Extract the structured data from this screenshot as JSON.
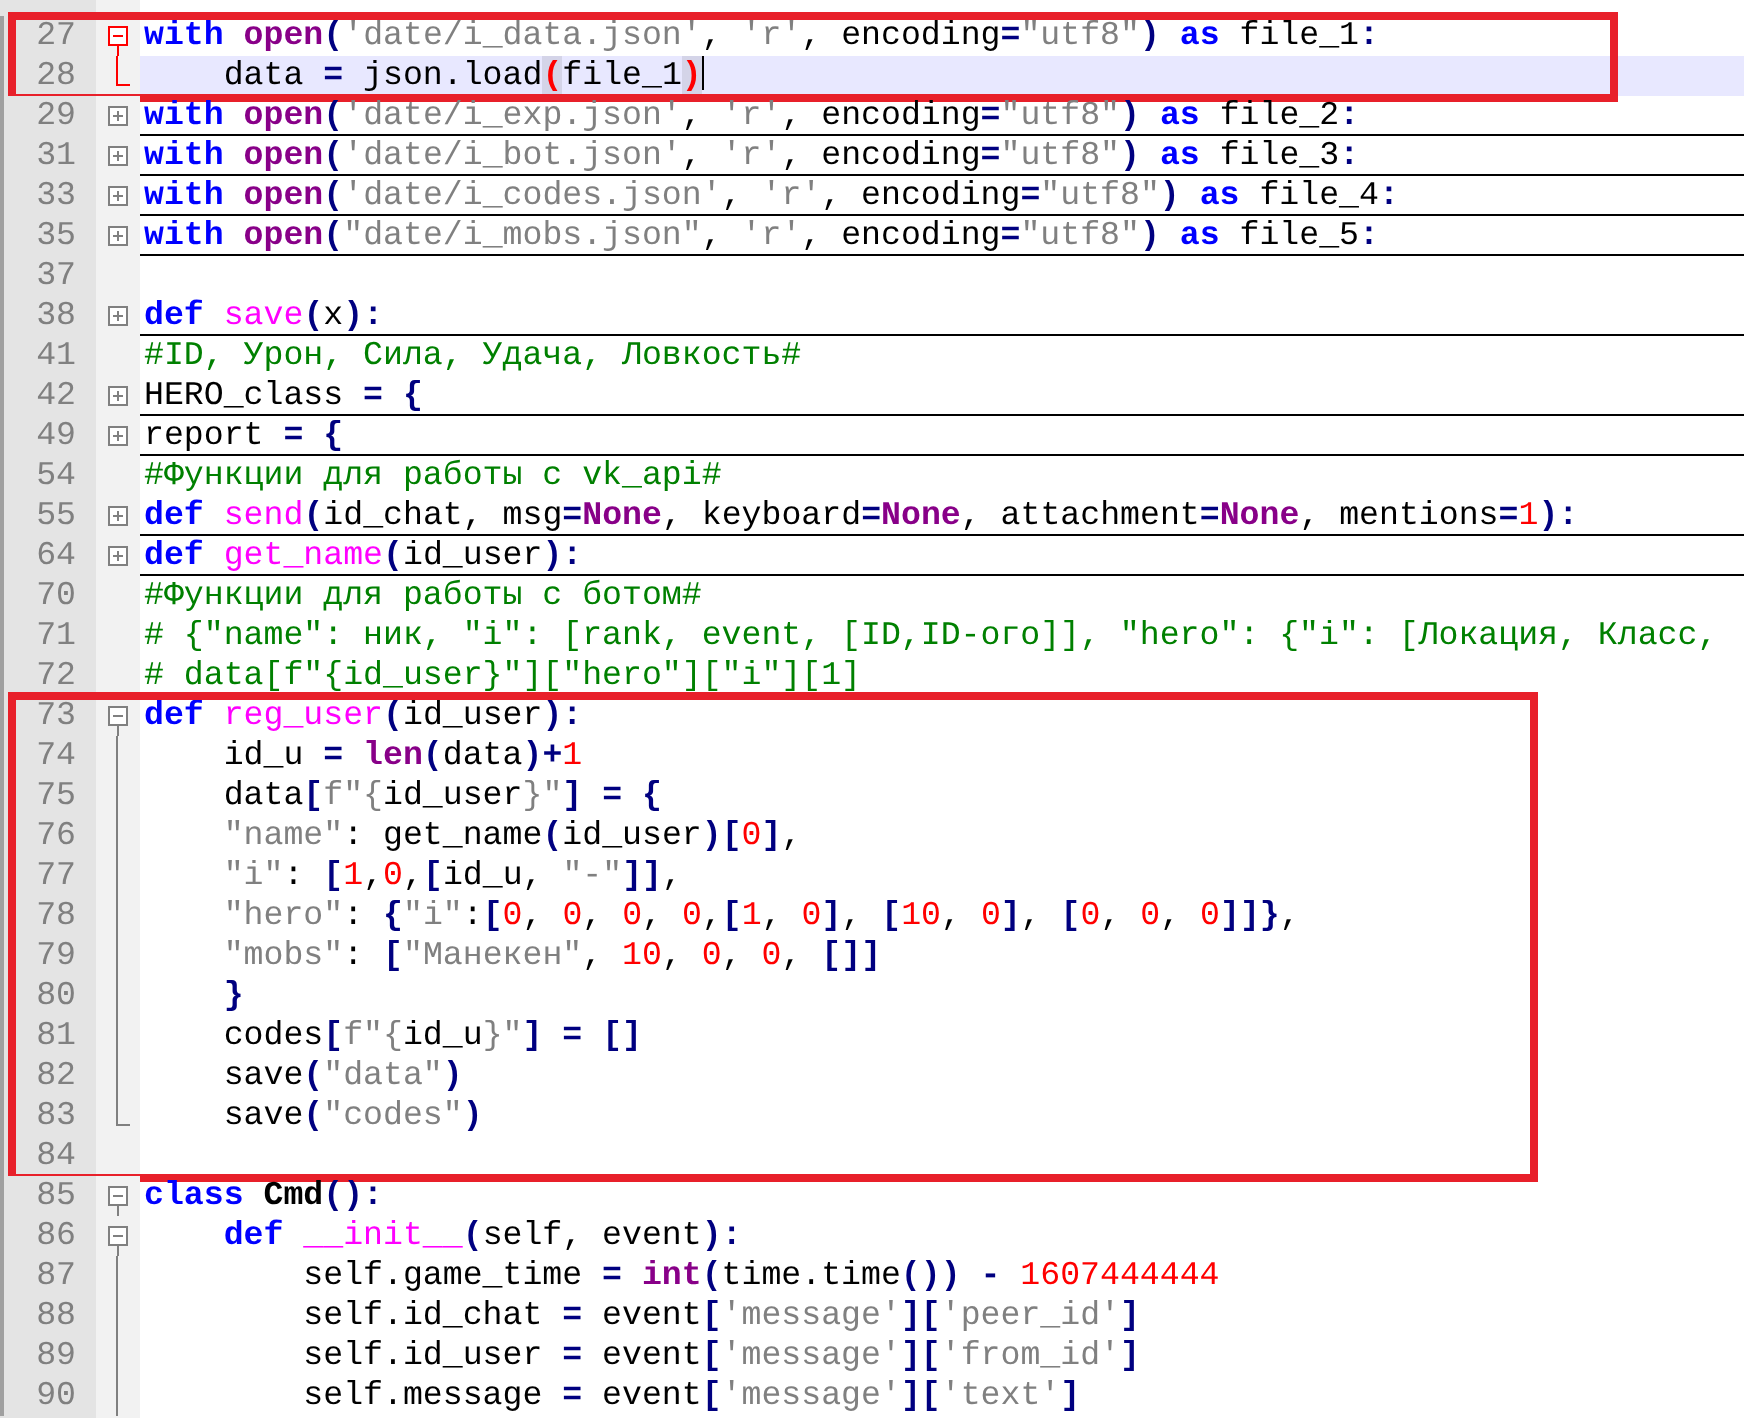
{
  "editor": {
    "blocks": [
      {
        "annotated": true,
        "fold_highlighted": true,
        "lines": [
          {
            "number": "27",
            "kind": "fold_open",
            "current": false,
            "tokens": [
              {
                "kind": "keyword",
                "text": "with "
              },
              {
                "kind": "builtin",
                "text": "open"
              },
              {
                "kind": "operator",
                "text": "("
              },
              {
                "kind": "string",
                "text": "'date/i_data.json'"
              },
              {
                "kind": "text",
                "text": ", "
              },
              {
                "kind": "string",
                "text": "'r'"
              },
              {
                "kind": "text",
                "text": ", encoding"
              },
              {
                "kind": "operator",
                "text": "="
              },
              {
                "kind": "string",
                "text": "\"utf8\""
              },
              {
                "kind": "operator",
                "text": ") "
              },
              {
                "kind": "keyword",
                "text": "as"
              },
              {
                "kind": "text",
                "text": " file_1"
              },
              {
                "kind": "operator",
                "text": ":"
              }
            ]
          },
          {
            "number": "28",
            "kind": "fold_end",
            "current": true,
            "tokens": [
              {
                "kind": "text",
                "text": "    data "
              },
              {
                "kind": "operator",
                "text": "="
              },
              {
                "kind": "text",
                "text": " json.load"
              },
              {
                "kind": "brace_match",
                "text": "("
              },
              {
                "kind": "text",
                "text": "file_1"
              },
              {
                "kind": "brace_match",
                "text": ")"
              }
            ]
          }
        ]
      },
      {
        "annotated": false,
        "fold_highlighted": false,
        "lines": [
          {
            "number": "29",
            "kind": "fold_closed",
            "current": false,
            "tokens": [
              {
                "kind": "keyword",
                "text": "with "
              },
              {
                "kind": "builtin",
                "text": "open"
              },
              {
                "kind": "operator",
                "text": "("
              },
              {
                "kind": "string",
                "text": "'date/i_exp.json'"
              },
              {
                "kind": "text",
                "text": ", "
              },
              {
                "kind": "string",
                "text": "'r'"
              },
              {
                "kind": "text",
                "text": ", encoding"
              },
              {
                "kind": "operator",
                "text": "="
              },
              {
                "kind": "string",
                "text": "\"utf8\""
              },
              {
                "kind": "operator",
                "text": ") "
              },
              {
                "kind": "keyword",
                "text": "as"
              },
              {
                "kind": "text",
                "text": " file_2"
              },
              {
                "kind": "operator",
                "text": ":"
              }
            ]
          },
          {
            "number": "31",
            "kind": "fold_closed",
            "current": false,
            "tokens": [
              {
                "kind": "keyword",
                "text": "with "
              },
              {
                "kind": "builtin",
                "text": "open"
              },
              {
                "kind": "operator",
                "text": "("
              },
              {
                "kind": "string",
                "text": "'date/i_bot.json'"
              },
              {
                "kind": "text",
                "text": ", "
              },
              {
                "kind": "string",
                "text": "'r'"
              },
              {
                "kind": "text",
                "text": ", encoding"
              },
              {
                "kind": "operator",
                "text": "="
              },
              {
                "kind": "string",
                "text": "\"utf8\""
              },
              {
                "kind": "operator",
                "text": ") "
              },
              {
                "kind": "keyword",
                "text": "as"
              },
              {
                "kind": "text",
                "text": " file_3"
              },
              {
                "kind": "operator",
                "text": ":"
              }
            ]
          },
          {
            "number": "33",
            "kind": "fold_closed",
            "current": false,
            "tokens": [
              {
                "kind": "keyword",
                "text": "with "
              },
              {
                "kind": "builtin",
                "text": "open"
              },
              {
                "kind": "operator",
                "text": "("
              },
              {
                "kind": "string",
                "text": "'date/i_codes.json'"
              },
              {
                "kind": "text",
                "text": ", "
              },
              {
                "kind": "string",
                "text": "'r'"
              },
              {
                "kind": "text",
                "text": ", encoding"
              },
              {
                "kind": "operator",
                "text": "="
              },
              {
                "kind": "string",
                "text": "\"utf8\""
              },
              {
                "kind": "operator",
                "text": ") "
              },
              {
                "kind": "keyword",
                "text": "as"
              },
              {
                "kind": "text",
                "text": " file_4"
              },
              {
                "kind": "operator",
                "text": ":"
              }
            ]
          },
          {
            "number": "35",
            "kind": "fold_closed",
            "current": false,
            "tokens": [
              {
                "kind": "keyword",
                "text": "with "
              },
              {
                "kind": "builtin",
                "text": "open"
              },
              {
                "kind": "operator",
                "text": "("
              },
              {
                "kind": "string",
                "text": "\"date/i_mobs.json\""
              },
              {
                "kind": "text",
                "text": ", "
              },
              {
                "kind": "string",
                "text": "'r'"
              },
              {
                "kind": "text",
                "text": ", encoding"
              },
              {
                "kind": "operator",
                "text": "="
              },
              {
                "kind": "string",
                "text": "\"utf8\""
              },
              {
                "kind": "operator",
                "text": ") "
              },
              {
                "kind": "keyword",
                "text": "as"
              },
              {
                "kind": "text",
                "text": " file_5"
              },
              {
                "kind": "operator",
                "text": ":"
              }
            ]
          },
          {
            "number": "37",
            "kind": "plain",
            "current": false
          },
          {
            "number": "38",
            "kind": "fold_closed",
            "current": false,
            "tokens": [
              {
                "kind": "keyword",
                "text": "def "
              },
              {
                "kind": "function",
                "text": "save"
              },
              {
                "kind": "operator",
                "text": "("
              },
              {
                "kind": "text",
                "text": "x"
              },
              {
                "kind": "operator",
                "text": "):"
              }
            ]
          },
          {
            "number": "41",
            "kind": "plain",
            "current": false,
            "tokens": [
              {
                "kind": "comment",
                "text": "#ID, Урон, Сила, Удача, Ловкость#"
              }
            ]
          },
          {
            "number": "42",
            "kind": "fold_closed",
            "current": false,
            "tokens": [
              {
                "kind": "text",
                "text": "HERO_class "
              },
              {
                "kind": "operator",
                "text": "= {"
              }
            ]
          },
          {
            "number": "49",
            "kind": "fold_closed",
            "current": false,
            "tokens": [
              {
                "kind": "text",
                "text": "report "
              },
              {
                "kind": "operator",
                "text": "= {"
              }
            ]
          },
          {
            "number": "54",
            "kind": "plain",
            "current": false,
            "tokens": [
              {
                "kind": "comment",
                "text": "#Функции для работы с vk_api#"
              }
            ]
          },
          {
            "number": "55",
            "kind": "fold_closed",
            "current": false,
            "tokens": [
              {
                "kind": "keyword",
                "text": "def "
              },
              {
                "kind": "function",
                "text": "send"
              },
              {
                "kind": "operator",
                "text": "("
              },
              {
                "kind": "text",
                "text": "id_chat, msg"
              },
              {
                "kind": "operator",
                "text": "="
              },
              {
                "kind": "builtin",
                "text": "None"
              },
              {
                "kind": "text",
                "text": ", keyboard"
              },
              {
                "kind": "operator",
                "text": "="
              },
              {
                "kind": "builtin",
                "text": "None"
              },
              {
                "kind": "text",
                "text": ", attachment"
              },
              {
                "kind": "operator",
                "text": "="
              },
              {
                "kind": "builtin",
                "text": "None"
              },
              {
                "kind": "text",
                "text": ", mentions"
              },
              {
                "kind": "operator",
                "text": "="
              },
              {
                "kind": "number",
                "text": "1"
              },
              {
                "kind": "operator",
                "text": "):"
              }
            ]
          },
          {
            "number": "64",
            "kind": "fold_closed",
            "current": false,
            "tokens": [
              {
                "kind": "keyword",
                "text": "def "
              },
              {
                "kind": "function",
                "text": "get_name"
              },
              {
                "kind": "operator",
                "text": "("
              },
              {
                "kind": "text",
                "text": "id_user"
              },
              {
                "kind": "operator",
                "text": "):"
              }
            ]
          },
          {
            "number": "70",
            "kind": "plain",
            "current": false,
            "tokens": [
              {
                "kind": "comment",
                "text": "#Функции для работы с ботом#"
              }
            ]
          },
          {
            "number": "71",
            "kind": "plain",
            "current": false,
            "tokens": [
              {
                "kind": "comment",
                "text": "# {\"name\": ник, \"i\": [rank, event, [ID,ID-ого]], \"hero\": {\"i\": [Локация, Класс,"
              }
            ]
          },
          {
            "number": "72",
            "kind": "plain",
            "current": false,
            "tokens": [
              {
                "kind": "comment",
                "text": "# data[f\"{id_user}\"][\"hero\"][\"i\"][1]"
              }
            ]
          }
        ]
      },
      {
        "annotated": true,
        "fold_highlighted": false,
        "lines": [
          {
            "number": "73",
            "kind": "fold_open",
            "current": false,
            "tokens": [
              {
                "kind": "keyword",
                "text": "def "
              },
              {
                "kind": "function",
                "text": "reg_user"
              },
              {
                "kind": "operator",
                "text": "("
              },
              {
                "kind": "text",
                "text": "id_user"
              },
              {
                "kind": "operator",
                "text": "):"
              }
            ]
          },
          {
            "number": "74",
            "kind": "fold_body",
            "current": false,
            "tokens": [
              {
                "kind": "text",
                "text": "    id_u "
              },
              {
                "kind": "operator",
                "text": "= "
              },
              {
                "kind": "builtin",
                "text": "len"
              },
              {
                "kind": "operator",
                "text": "("
              },
              {
                "kind": "text",
                "text": "data"
              },
              {
                "kind": "operator",
                "text": ")+"
              },
              {
                "kind": "number",
                "text": "1"
              }
            ]
          },
          {
            "number": "75",
            "kind": "fold_body",
            "current": false,
            "tokens": [
              {
                "kind": "text",
                "text": "    data"
              },
              {
                "kind": "operator",
                "text": "["
              },
              {
                "kind": "string",
                "text": "f\"{"
              },
              {
                "kind": "text",
                "text": "id_user"
              },
              {
                "kind": "string",
                "text": "}\""
              },
              {
                "kind": "operator",
                "text": "] = {"
              }
            ]
          },
          {
            "number": "76",
            "kind": "fold_body",
            "current": false,
            "tokens": [
              {
                "kind": "string",
                "text": "    \"name\""
              },
              {
                "kind": "text",
                "text": ": get_name"
              },
              {
                "kind": "operator",
                "text": "("
              },
              {
                "kind": "text",
                "text": "id_user"
              },
              {
                "kind": "operator",
                "text": ")["
              },
              {
                "kind": "number",
                "text": "0"
              },
              {
                "kind": "operator",
                "text": "]"
              },
              {
                "kind": "text",
                "text": ","
              }
            ]
          },
          {
            "number": "77",
            "kind": "fold_body",
            "current": false,
            "tokens": [
              {
                "kind": "string",
                "text": "    \"i\""
              },
              {
                "kind": "text",
                "text": ": "
              },
              {
                "kind": "operator",
                "text": "["
              },
              {
                "kind": "number",
                "text": "1"
              },
              {
                "kind": "text",
                "text": ","
              },
              {
                "kind": "number",
                "text": "0"
              },
              {
                "kind": "text",
                "text": ","
              },
              {
                "kind": "operator",
                "text": "["
              },
              {
                "kind": "text",
                "text": "id_u, "
              },
              {
                "kind": "string",
                "text": "\"-\""
              },
              {
                "kind": "operator",
                "text": "]]"
              },
              {
                "kind": "text",
                "text": ","
              }
            ]
          },
          {
            "number": "78",
            "kind": "fold_body",
            "current": false,
            "tokens": [
              {
                "kind": "string",
                "text": "    \"hero\""
              },
              {
                "kind": "text",
                "text": ": "
              },
              {
                "kind": "operator",
                "text": "{"
              },
              {
                "kind": "string",
                "text": "\"i\""
              },
              {
                "kind": "text",
                "text": ":"
              },
              {
                "kind": "operator",
                "text": "["
              },
              {
                "kind": "number",
                "text": "0"
              },
              {
                "kind": "text",
                "text": ", "
              },
              {
                "kind": "number",
                "text": "0"
              },
              {
                "kind": "text",
                "text": ", "
              },
              {
                "kind": "number",
                "text": "0"
              },
              {
                "kind": "text",
                "text": ", "
              },
              {
                "kind": "number",
                "text": "0"
              },
              {
                "kind": "text",
                "text": ","
              },
              {
                "kind": "operator",
                "text": "["
              },
              {
                "kind": "number",
                "text": "1"
              },
              {
                "kind": "text",
                "text": ", "
              },
              {
                "kind": "number",
                "text": "0"
              },
              {
                "kind": "operator",
                "text": "]"
              },
              {
                "kind": "text",
                "text": ", "
              },
              {
                "kind": "operator",
                "text": "["
              },
              {
                "kind": "number",
                "text": "10"
              },
              {
                "kind": "text",
                "text": ", "
              },
              {
                "kind": "number",
                "text": "0"
              },
              {
                "kind": "operator",
                "text": "]"
              },
              {
                "kind": "text",
                "text": ", "
              },
              {
                "kind": "operator",
                "text": "["
              },
              {
                "kind": "number",
                "text": "0"
              },
              {
                "kind": "text",
                "text": ", "
              },
              {
                "kind": "number",
                "text": "0"
              },
              {
                "kind": "text",
                "text": ", "
              },
              {
                "kind": "number",
                "text": "0"
              },
              {
                "kind": "operator",
                "text": "]]}"
              },
              {
                "kind": "text",
                "text": ","
              }
            ]
          },
          {
            "number": "79",
            "kind": "fold_body",
            "current": false,
            "tokens": [
              {
                "kind": "string",
                "text": "    \"mobs\""
              },
              {
                "kind": "text",
                "text": ": "
              },
              {
                "kind": "operator",
                "text": "["
              },
              {
                "kind": "string",
                "text": "\"Манекен\""
              },
              {
                "kind": "text",
                "text": ", "
              },
              {
                "kind": "number",
                "text": "10"
              },
              {
                "kind": "text",
                "text": ", "
              },
              {
                "kind": "number",
                "text": "0"
              },
              {
                "kind": "text",
                "text": ", "
              },
              {
                "kind": "number",
                "text": "0"
              },
              {
                "kind": "text",
                "text": ", "
              },
              {
                "kind": "operator",
                "text": "[]]"
              }
            ]
          },
          {
            "number": "80",
            "kind": "fold_body",
            "current": false,
            "tokens": [
              {
                "kind": "operator",
                "text": "    }"
              }
            ]
          },
          {
            "number": "81",
            "kind": "fold_body",
            "current": false,
            "tokens": [
              {
                "kind": "text",
                "text": "    codes"
              },
              {
                "kind": "operator",
                "text": "["
              },
              {
                "kind": "string",
                "text": "f\"{"
              },
              {
                "kind": "text",
                "text": "id_u"
              },
              {
                "kind": "string",
                "text": "}\""
              },
              {
                "kind": "operator",
                "text": "] = []"
              }
            ]
          },
          {
            "number": "82",
            "kind": "fold_body",
            "current": false,
            "tokens": [
              {
                "kind": "text",
                "text": "    save"
              },
              {
                "kind": "operator",
                "text": "("
              },
              {
                "kind": "string",
                "text": "\"data\""
              },
              {
                "kind": "operator",
                "text": ")"
              }
            ]
          },
          {
            "number": "83",
            "kind": "fold_end",
            "current": false,
            "tokens": [
              {
                "kind": "text",
                "text": "    save"
              },
              {
                "kind": "operator",
                "text": "("
              },
              {
                "kind": "string",
                "text": "\"codes\""
              },
              {
                "kind": "operator",
                "text": ")"
              }
            ]
          },
          {
            "number": "84",
            "kind": "plain",
            "current": false
          }
        ]
      },
      {
        "annotated": false,
        "fold_highlighted": false,
        "lines": [
          {
            "number": "85",
            "kind": "fold_open",
            "current": false,
            "tokens": [
              {
                "kind": "keyword",
                "text": "class "
              },
              {
                "kind": "class_name",
                "text": "Cmd"
              },
              {
                "kind": "operator",
                "text": "():"
              }
            ]
          },
          {
            "number": "86",
            "kind": "fold_open",
            "current": false,
            "tokens": [
              {
                "kind": "keyword",
                "text": "    def "
              },
              {
                "kind": "function",
                "text": "__init__"
              },
              {
                "kind": "operator",
                "text": "("
              },
              {
                "kind": "text",
                "text": "self, event"
              },
              {
                "kind": "operator",
                "text": "):"
              }
            ]
          },
          {
            "number": "87",
            "kind": "fold_body",
            "current": false,
            "tokens": [
              {
                "kind": "text",
                "text": "        self.game_time "
              },
              {
                "kind": "operator",
                "text": "= "
              },
              {
                "kind": "builtin",
                "text": "int"
              },
              {
                "kind": "operator",
                "text": "("
              },
              {
                "kind": "text",
                "text": "time.time"
              },
              {
                "kind": "operator",
                "text": "()) - "
              },
              {
                "kind": "number",
                "text": "1607444444"
              }
            ]
          },
          {
            "number": "88",
            "kind": "fold_body",
            "current": false,
            "tokens": [
              {
                "kind": "text",
                "text": "        self.id_chat "
              },
              {
                "kind": "operator",
                "text": "="
              },
              {
                "kind": "text",
                "text": " event"
              },
              {
                "kind": "operator",
                "text": "["
              },
              {
                "kind": "string",
                "text": "'message'"
              },
              {
                "kind": "operator",
                "text": "]["
              },
              {
                "kind": "string",
                "text": "'peer_id'"
              },
              {
                "kind": "operator",
                "text": "]"
              }
            ]
          },
          {
            "number": "89",
            "kind": "fold_body",
            "current": false,
            "tokens": [
              {
                "kind": "text",
                "text": "        self.id_user "
              },
              {
                "kind": "operator",
                "text": "="
              },
              {
                "kind": "text",
                "text": " event"
              },
              {
                "kind": "operator",
                "text": "["
              },
              {
                "kind": "string",
                "text": "'message'"
              },
              {
                "kind": "operator",
                "text": "]["
              },
              {
                "kind": "string",
                "text": "'from_id'"
              },
              {
                "kind": "operator",
                "text": "]"
              }
            ]
          },
          {
            "number": "90",
            "kind": "fold_body",
            "current": false,
            "tokens": [
              {
                "kind": "text",
                "text": "        self.message "
              },
              {
                "kind": "operator",
                "text": "="
              },
              {
                "kind": "text",
                "text": " event"
              },
              {
                "kind": "operator",
                "text": "["
              },
              {
                "kind": "string",
                "text": "'message'"
              },
              {
                "kind": "operator",
                "text": "]["
              },
              {
                "kind": "string",
                "text": "'text'"
              },
              {
                "kind": "operator",
                "text": "]"
              }
            ]
          }
        ]
      }
    ]
  }
}
